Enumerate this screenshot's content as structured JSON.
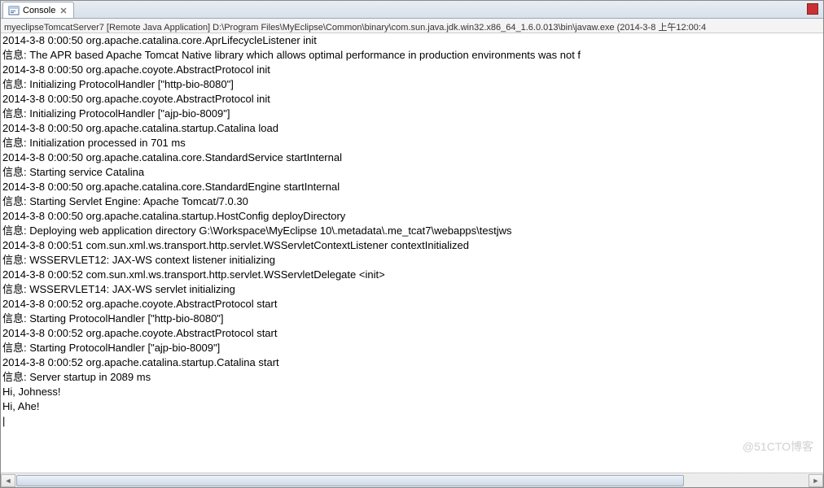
{
  "tab": {
    "label": "Console",
    "close_glyph": "×"
  },
  "breadcrumb": "myeclipseTomcatServer7 [Remote Java Application] D:\\Program Files\\MyEclipse\\Common\\binary\\com.sun.java.jdk.win32.x86_64_1.6.0.013\\bin\\javaw.exe (2014-3-8 上午12:00:4",
  "watermark": "@51CTO博客",
  "console_lines": [
    "2014-3-8 0:00:50 org.apache.catalina.core.AprLifecycleListener init",
    "信息: The APR based Apache Tomcat Native library which allows optimal performance in production environments was not f",
    "2014-3-8 0:00:50 org.apache.coyote.AbstractProtocol init",
    "信息: Initializing ProtocolHandler [\"http-bio-8080\"]",
    "2014-3-8 0:00:50 org.apache.coyote.AbstractProtocol init",
    "信息: Initializing ProtocolHandler [\"ajp-bio-8009\"]",
    "2014-3-8 0:00:50 org.apache.catalina.startup.Catalina load",
    "信息: Initialization processed in 701 ms",
    "2014-3-8 0:00:50 org.apache.catalina.core.StandardService startInternal",
    "信息: Starting service Catalina",
    "2014-3-8 0:00:50 org.apache.catalina.core.StandardEngine startInternal",
    "信息: Starting Servlet Engine: Apache Tomcat/7.0.30",
    "2014-3-8 0:00:50 org.apache.catalina.startup.HostConfig deployDirectory",
    "信息: Deploying web application directory G:\\Workspace\\MyEclipse 10\\.metadata\\.me_tcat7\\webapps\\testjws",
    "2014-3-8 0:00:51 com.sun.xml.ws.transport.http.servlet.WSServletContextListener contextInitialized",
    "信息: WSSERVLET12: JAX-WS context listener initializing",
    "2014-3-8 0:00:52 com.sun.xml.ws.transport.http.servlet.WSServletDelegate <init>",
    "信息: WSSERVLET14: JAX-WS servlet initializing",
    "2014-3-8 0:00:52 org.apache.coyote.AbstractProtocol start",
    "信息: Starting ProtocolHandler [\"http-bio-8080\"]",
    "2014-3-8 0:00:52 org.apache.coyote.AbstractProtocol start",
    "信息: Starting ProtocolHandler [\"ajp-bio-8009\"]",
    "2014-3-8 0:00:52 org.apache.catalina.startup.Catalina start",
    "信息: Server startup in 2089 ms",
    "Hi, Johness!",
    "Hi, Ahe!"
  ]
}
